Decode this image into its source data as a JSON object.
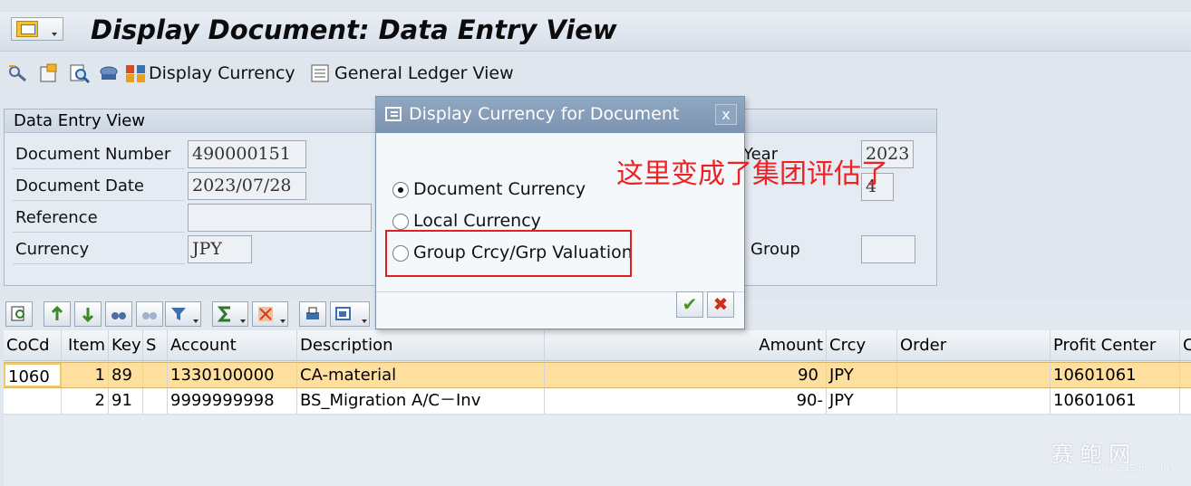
{
  "window": {
    "title": "Display Document: Data Entry View"
  },
  "toolbar": {
    "display_currency": "Display Currency",
    "general_ledger_view": "General Ledger View"
  },
  "header_box": {
    "title": "Data Entry View",
    "fields": {
      "doc_number_label": "Document Number",
      "doc_number": "490000151",
      "doc_date_label": "Document Date",
      "doc_date": "2023/07/28",
      "reference_label": "Reference",
      "reference": "",
      "currency_label": "Currency",
      "currency": "JPY",
      "year_label_partial": "Year",
      "year": "2023",
      "period": "4",
      "group_label": "Group",
      "group": ""
    }
  },
  "table": {
    "columns": [
      "CoCd",
      "Item",
      "Key",
      "S",
      "Account",
      "Description",
      "Amount",
      "Crcy",
      "Order",
      "Profit Center",
      "C"
    ],
    "rows": [
      {
        "cocd": "1060",
        "item": "1",
        "key": "89",
        "s": "",
        "account": "1330100000",
        "description": "CA-material",
        "amount": "90",
        "crcy": "JPY",
        "order": "",
        "profit_center": "10601061"
      },
      {
        "cocd": "",
        "item": "2",
        "key": "91",
        "s": "",
        "account": "9999999998",
        "description": "BS_Migration A/C－Inv",
        "amount": "90-",
        "crcy": "JPY",
        "order": "",
        "profit_center": "10601061"
      }
    ]
  },
  "dialog": {
    "title": "Display Currency for Document",
    "options": [
      {
        "label": "Document Currency",
        "selected": true
      },
      {
        "label": "Local Currency",
        "selected": false
      },
      {
        "label": "Group Crcy/Grp Valuation",
        "selected": false
      }
    ],
    "close": "x",
    "ok": "✔",
    "cancel": "✖"
  },
  "annotation": "这里变成了集团评估了",
  "watermark": {
    "text": "赛 鲍 网",
    "url": "www.91Sap.com"
  },
  "colors": {
    "selected_row": "#ffdf9e",
    "annotation_red": "#ee2222",
    "dialog_title": "#7b93b0"
  }
}
